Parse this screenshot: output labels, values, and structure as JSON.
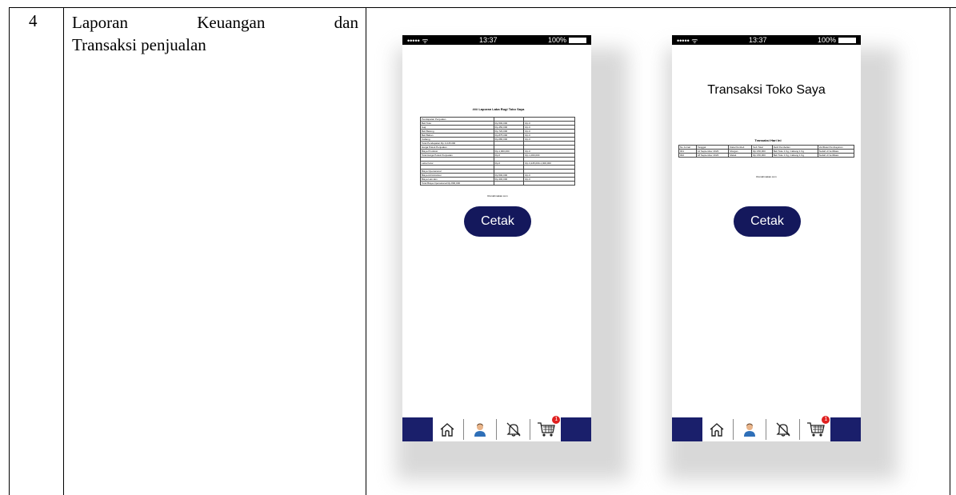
{
  "row": {
    "number": "4",
    "title_line1_words": [
      "Laporan",
      "Keuangan",
      "dan"
    ],
    "title_line2": "Transaksi penjualan"
  },
  "phone_status": {
    "signal": "••••• ᯤ",
    "time": "13:37",
    "battery": "100%"
  },
  "screen1": {
    "doc_title": "### Laporan Laba Rugi Toko Saya",
    "rows": [
      [
        "Pendapatan Penjualan",
        "",
        ""
      ],
      [
        "Beli Toko",
        "Rp.500,000",
        "Rp.0"
      ],
      [
        "Gaji",
        "Rp.450,000",
        "Rp.0"
      ],
      [
        "Beli Barang",
        "Rp.720,000",
        "Rp.0"
      ],
      [
        "Beli Bahan",
        "Rp.875,000",
        "Rp.0"
      ],
      [
        "Cabang",
        "Rp.680,000",
        "Rp.0"
      ],
      [
        "Total Pendapatan Rp.3.245.000",
        "",
        ""
      ],
      [
        "Harga Pokok Penjualan",
        "",
        ""
      ],
      [
        "Biaya Produksi",
        "Rp.1,000,000",
        "Rp.0"
      ],
      [
        "Total Harga Pokok Penjualan",
        "Rp.0",
        "Rp.1,000,000"
      ],
      [
        "",
        "",
        ""
      ],
      [
        "Laba Kotor",
        "Rp.0",
        "Rp.3,245,000-1,000,000"
      ],
      [
        "",
        "",
        ""
      ],
      [
        "Biaya Operasional",
        "",
        ""
      ],
      [
        "Biaya Administrasi",
        "Rp.500,000",
        "Rp.0"
      ],
      [
        "Biaya Lain-lain",
        "Rp.300,000",
        "Rp.0"
      ],
      [
        "Total Biaya Operasional Rp.800,000",
        "",
        ""
      ]
    ],
    "footer": "Rumahmakan.com",
    "button": "Cetak"
  },
  "screen2": {
    "heading": "Transaksi Toko Saya",
    "doc_title": "Transaksi Hari Ini",
    "headers": [
      "No Jurnal",
      "Tanggal",
      "Data Pembeli",
      "Sub Total",
      "Detil Pembelian",
      "Verifikasi Pembayaran"
    ],
    "rows": [
      [
        "001",
        "12 September 2023",
        "Morgan",
        "Rp.150,000",
        "Beli Toko 1 Kg, Cabang 1 Kg",
        "Sudah di Verifikasi"
      ],
      [
        "002",
        "18 September 2023",
        "Melati",
        "Rp.150,000",
        "Beli Toko 1 Kg, Cabang 1 Kg",
        "Sudah di Verifikasi"
      ]
    ],
    "footer": "Rumahmakan.com",
    "button": "Cetak"
  },
  "nav": {
    "icons": [
      "home-icon",
      "profile-icon",
      "notification-off-icon",
      "cart-icon"
    ],
    "cart_badge": "1",
    "bar_color": "#1a1f6b"
  },
  "colors": {
    "button": "#14185c"
  }
}
